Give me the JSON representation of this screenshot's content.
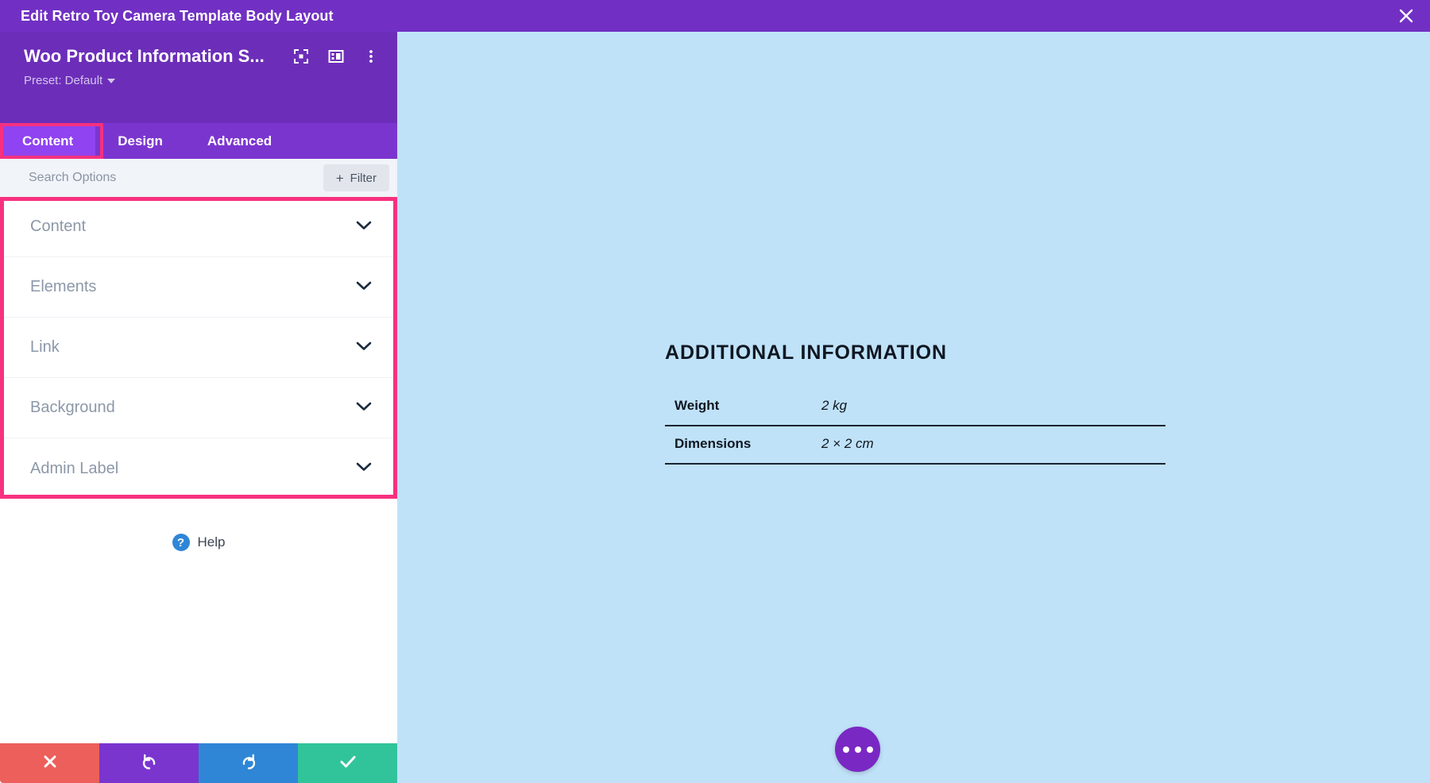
{
  "window": {
    "title": "Edit Retro Toy Camera Template Body Layout",
    "close_icon": "close-icon"
  },
  "panel": {
    "module_title": "Woo Product Information S...",
    "preset_label": "Preset: Default",
    "header_icons": [
      {
        "name": "focus-target-icon"
      },
      {
        "name": "layout-panel-icon"
      },
      {
        "name": "more-vertical-icon"
      }
    ],
    "tabs": [
      {
        "label": "Content",
        "active": true
      },
      {
        "label": "Design",
        "active": false
      },
      {
        "label": "Advanced",
        "active": false
      }
    ],
    "search": {
      "placeholder": "Search Options",
      "value": ""
    },
    "filter_button": {
      "label": "Filter",
      "icon": "plus-icon"
    },
    "accordion_sections": [
      {
        "label": "Content"
      },
      {
        "label": "Elements"
      },
      {
        "label": "Link"
      },
      {
        "label": "Background"
      },
      {
        "label": "Admin Label"
      }
    ],
    "help": {
      "label": "Help",
      "icon_glyph": "?"
    },
    "actions": [
      {
        "name": "cancel-button",
        "icon": "close-icon",
        "color": "#ec5f5b"
      },
      {
        "name": "undo-button",
        "icon": "undo-icon",
        "color": "#7b35cf"
      },
      {
        "name": "redo-button",
        "icon": "redo-icon",
        "color": "#2f86d6"
      },
      {
        "name": "save-button",
        "icon": "check-icon",
        "color": "#31c49a"
      }
    ]
  },
  "preview": {
    "background_color": "#bfe2f8",
    "heading": "ADDITIONAL INFORMATION",
    "attributes": [
      {
        "key": "Weight",
        "value": "2 kg"
      },
      {
        "key": "Dimensions",
        "value": "2 × 2 cm"
      }
    ],
    "fab": {
      "name": "page-settings-fab",
      "icon": "ellipsis-icon"
    }
  },
  "colors": {
    "titlebar": "#7130c3",
    "panel_header": "#6c2eb9",
    "tabs_bar": "#7b35cf",
    "tab_active": "#9043f0",
    "highlight": "#f7317f",
    "preview_bg": "#bfe2f8"
  }
}
